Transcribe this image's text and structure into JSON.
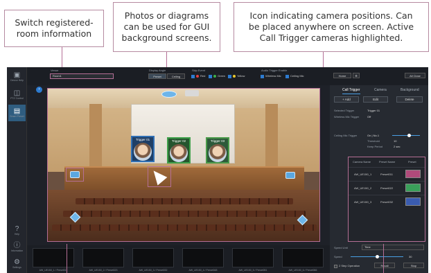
{
  "callouts": {
    "switch_info": "Switch registered-\nroom information",
    "background": "Photos or diagrams\ncan be used for GUI\nbackground screens.",
    "camera_icon": "Icon indicating camera positions. Can\nbe placed anywhere on screen. Active\nCall Trigger cameras highlighted."
  },
  "nav": [
    {
      "label": "Device Help",
      "icon": "device-icon"
    },
    {
      "label": "PTZ Control",
      "icon": "ptz-icon"
    },
    {
      "label": "Smart Preset",
      "icon": "preset-icon"
    },
    {
      "label": "Help",
      "icon": "help-icon"
    },
    {
      "label": "Information",
      "icon": "info-icon"
    },
    {
      "label": "Settings",
      "icon": "settings-icon"
    }
  ],
  "topbar": {
    "venue_label": "Venue",
    "venue_value": "Room1",
    "display_angle_label": "Display Angle",
    "angle_buttons": [
      "Preset",
      "Ceiling"
    ],
    "skip_event_label": "Skip Event",
    "events": [
      {
        "label": "Red",
        "color": "#e04040"
      },
      {
        "label": "Green",
        "color": "#3eb04a"
      },
      {
        "label": "Yellow",
        "color": "#e8c830"
      }
    ],
    "audio_label": "Audio Trigger Enable",
    "audio": [
      "Wireless Mic",
      "Ceiling Mic"
    ],
    "home_label": "Home",
    "all_close_label": "All Close"
  },
  "stage": {
    "triggers": [
      "Trigger 01",
      "Trigger 02",
      "Trigger 03"
    ]
  },
  "right_panel": {
    "tabs": [
      "Call Trigger",
      "Camera",
      "Background"
    ],
    "buttons": [
      "+ Add",
      "Edit",
      "Delete"
    ],
    "rows": [
      {
        "label": "Selected Trigger",
        "value": "Trigger 01"
      },
      {
        "label": "Wireless Mic Trigger",
        "value": "Off"
      },
      {
        "label": "Ceiling Mic Trigger",
        "value": "On | No.1"
      },
      {
        "label": "Threshold",
        "value": "10"
      },
      {
        "label": "Keep Period",
        "value": "2 sec"
      }
    ],
    "table": {
      "headers": [
        "Camera Name",
        "Preset Name",
        "Preset"
      ],
      "rows": [
        {
          "camera": "AW_UE150_1",
          "preset": "Preset011",
          "color": "#b04a7a"
        },
        {
          "camera": "AW_UE150_2",
          "preset": "Preset022",
          "color": "#3aa05a"
        },
        {
          "camera": "AW_UE150_3",
          "preset": "Preset032",
          "color": "#3a5cb0"
        }
      ]
    },
    "speed_unit_label": "Speed Unit",
    "speed_unit_value": "Time",
    "speed_label": "Speed",
    "speed_value": "30",
    "step_label": "2 Step Operation",
    "recall_label": "Recall",
    "stop_label": "Stop"
  },
  "thumbs": [
    "AW_UE150_1 / Preset011",
    "AW_UE150_2 / Preset023",
    "AW_UE150_3 / Preset032",
    "AW_UE150_4 / Preset048",
    "AW_UE150_5 / Preset051",
    "AW_UE150_6 / Preset066"
  ]
}
